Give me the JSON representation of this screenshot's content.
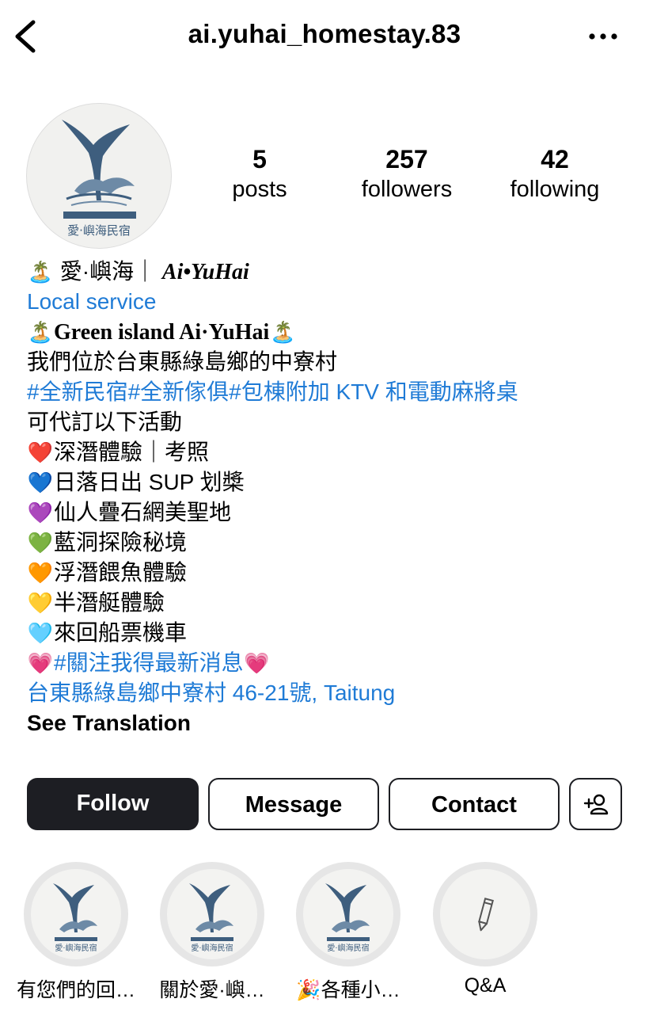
{
  "header": {
    "username": "ai.yuhai_homestay.83",
    "back_icon": "chevron-left-icon",
    "more_icon": "more-horizontal-icon"
  },
  "profile": {
    "avatar_icon": "whale-tail-logo",
    "logo_caption": "愛·嶼海民宿",
    "stats": [
      {
        "value": "5",
        "label": "posts"
      },
      {
        "value": "257",
        "label": "followers"
      },
      {
        "value": "42",
        "label": "following"
      }
    ]
  },
  "bio": {
    "name_cjk": "愛·嶼海｜",
    "name_latin": "Ai•YuHai",
    "category": "Local service",
    "tagline": "Green island Ai·YuHai",
    "location_line": "我們位於台東縣綠島鄉的中寮村",
    "hashtags": "#全新民宿#全新傢俱#包棟附加 KTV 和電動麻將桌",
    "activities_intro": "可代訂以下活動",
    "activities": [
      {
        "icon": "red-heart-icon",
        "emoji": "❤️",
        "text": "深潛體驗｜考照"
      },
      {
        "icon": "blue-heart-icon",
        "emoji": "💙",
        "text": "日落日出 SUP 划槳"
      },
      {
        "icon": "purple-heart-icon",
        "emoji": "💜",
        "text": "仙人疊石網美聖地"
      },
      {
        "icon": "green-heart-icon",
        "emoji": "💚",
        "text": "藍洞探險秘境"
      },
      {
        "icon": "orange-heart-icon",
        "emoji": "🧡",
        "text": "浮潛餵魚體驗"
      },
      {
        "icon": "yellow-heart-icon",
        "emoji": "💛",
        "text": "半潛艇體驗"
      },
      {
        "icon": "light-blue-heart-icon",
        "emoji": "🩵",
        "text": "來回船票機車"
      }
    ],
    "follow_hashtag": "#關注我得最新消息",
    "address": "台東縣綠島鄉中寮村 46-21號, Taitung",
    "see_translation": "See Translation",
    "island_emoji": "🏝️",
    "pink_heart_emoji": "💗"
  },
  "actions": {
    "follow": "Follow",
    "message": "Message",
    "contact": "Contact",
    "suggest_icon": "add-person-icon"
  },
  "highlights": [
    {
      "label": "有您們的回…",
      "icon": "whale-tail-logo"
    },
    {
      "label": "關於愛·嶼…",
      "icon": "whale-tail-logo"
    },
    {
      "label": "各種小…",
      "icon": "whale-tail-logo",
      "emoji": "🎉"
    },
    {
      "label": "Q&A",
      "icon": "pencil-icon"
    }
  ],
  "colors": {
    "link_blue": "#1f7bd6",
    "follow_button": "#1d1e23",
    "highlight_ring": "#e6e6e6"
  }
}
